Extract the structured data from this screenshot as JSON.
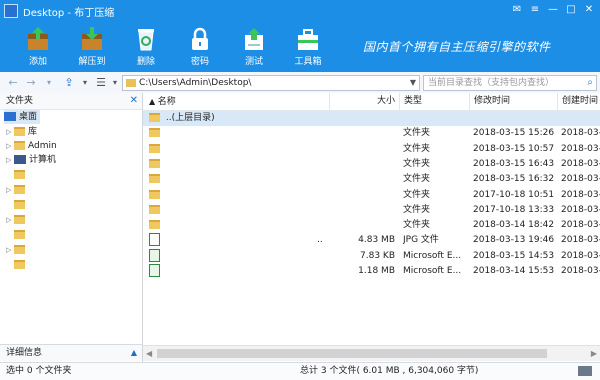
{
  "window": {
    "title": "Desktop - 布丁压缩",
    "controls": [
      "mail-icon",
      "menu-icon",
      "minimize-icon",
      "maximize-icon",
      "close-icon"
    ]
  },
  "toolbar": {
    "buttons": [
      {
        "label": "添加",
        "icon": "add-archive-icon"
      },
      {
        "label": "解压到",
        "icon": "extract-icon"
      },
      {
        "label": "删除",
        "icon": "recycle-bin-icon"
      },
      {
        "label": "密码",
        "icon": "lock-icon"
      },
      {
        "label": "测试",
        "icon": "test-icon"
      },
      {
        "label": "工具箱",
        "icon": "toolbox-icon"
      }
    ],
    "slogan": "国内首个拥有自主压缩引擎的软件"
  },
  "addressbar": {
    "path": "C:\\Users\\Admin\\Desktop\\",
    "search_placeholder": "当前目录查找（支持包内查找）"
  },
  "sidebar": {
    "header": "文件夹",
    "close": "✕",
    "items": [
      {
        "label": "桌面",
        "icon": "desktop-icon",
        "selected": true
      },
      {
        "label": "库",
        "icon": "folder-icon"
      },
      {
        "label": "Admin",
        "icon": "folder-icon"
      },
      {
        "label": "计算机",
        "icon": "computer-icon"
      },
      {
        "label": "",
        "icon": "folder-icon"
      },
      {
        "label": "",
        "icon": "folder-icon"
      },
      {
        "label": "",
        "icon": "folder-icon"
      },
      {
        "label": "",
        "icon": "folder-icon"
      },
      {
        "label": "",
        "icon": "folder-icon"
      },
      {
        "label": "",
        "icon": "folder-icon"
      },
      {
        "label": "",
        "icon": "folder-icon"
      }
    ],
    "details_header": "详细信息"
  },
  "columns": {
    "name": "名称",
    "size": "大小",
    "type": "类型",
    "modified": "修改时间",
    "created": "创建时间"
  },
  "rows": [
    {
      "name": "..(上层目录)",
      "size": "",
      "type": "",
      "modified": "",
      "created": "",
      "icon": "folder"
    },
    {
      "name": "",
      "size": "",
      "type": "文件夹",
      "modified": "2018-03-15 15:26",
      "created": "2018-03-",
      "icon": "folder"
    },
    {
      "name": "",
      "size": "",
      "type": "文件夹",
      "modified": "2018-03-15 10:57",
      "created": "2018-03-",
      "icon": "folder"
    },
    {
      "name": "",
      "size": "",
      "type": "文件夹",
      "modified": "2018-03-15 16:43",
      "created": "2018-03-",
      "icon": "folder"
    },
    {
      "name": "",
      "size": "",
      "type": "文件夹",
      "modified": "2018-03-15 16:32",
      "created": "2018-03-",
      "icon": "folder"
    },
    {
      "name": "",
      "size": "",
      "type": "文件夹",
      "modified": "2017-10-18 10:51",
      "created": "2018-03-",
      "icon": "folder"
    },
    {
      "name": "",
      "size": "",
      "type": "文件夹",
      "modified": "2017-10-18 13:33",
      "created": "2018-03-",
      "icon": "folder"
    },
    {
      "name": "",
      "size": "",
      "type": "文件夹",
      "modified": "2018-03-14 18:42",
      "created": "2018-03-",
      "icon": "folder"
    },
    {
      "name": "..",
      "size": "4.83 MB",
      "type": "JPG 文件",
      "modified": "2018-03-13 19:46",
      "created": "2018-03-",
      "icon": "jpg"
    },
    {
      "name": "",
      "size": "7.83 KB",
      "type": "Microsoft E...",
      "modified": "2018-03-15 14:53",
      "created": "2018-03-",
      "icon": "excel"
    },
    {
      "name": "",
      "size": "1.18 MB",
      "type": "Microsoft E...",
      "modified": "2018-03-14 15:53",
      "created": "2018-03-",
      "icon": "excel"
    }
  ],
  "status": {
    "left": "选中 0 个文件夹",
    "right": "总计 3 个文件( 6.01 MB , 6,304,060 字节)"
  }
}
